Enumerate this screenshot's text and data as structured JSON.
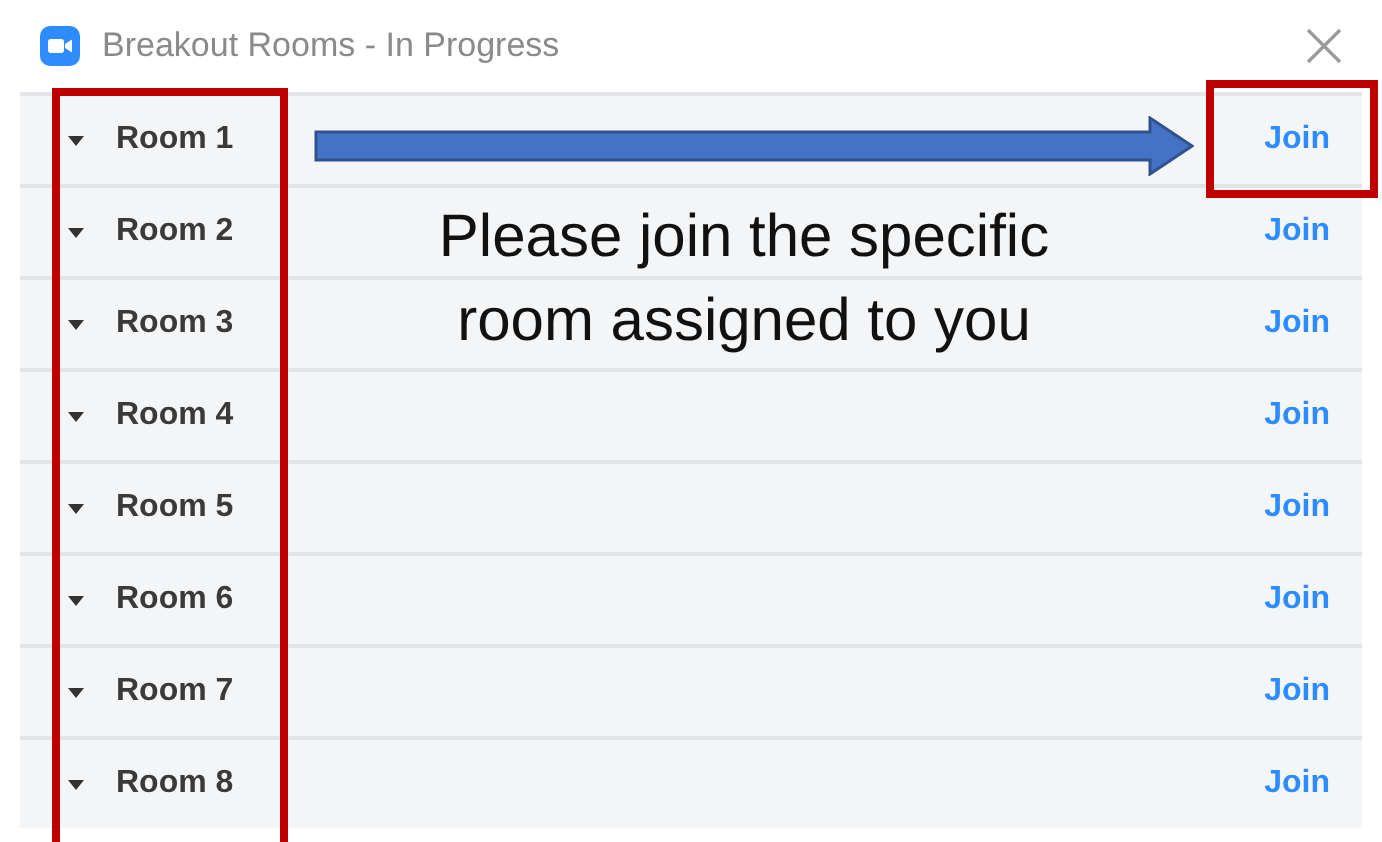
{
  "window": {
    "title": "Breakout Rooms - In Progress"
  },
  "rooms": [
    {
      "name": "Room 1",
      "action": "Join"
    },
    {
      "name": "Room 2",
      "action": "Join"
    },
    {
      "name": "Room 3",
      "action": "Join"
    },
    {
      "name": "Room 4",
      "action": "Join"
    },
    {
      "name": "Room 5",
      "action": "Join"
    },
    {
      "name": "Room 6",
      "action": "Join"
    },
    {
      "name": "Room 7",
      "action": "Join"
    },
    {
      "name": "Room 8",
      "action": "Join"
    }
  ],
  "annotation": {
    "text": "Please join the specific room assigned to you"
  }
}
